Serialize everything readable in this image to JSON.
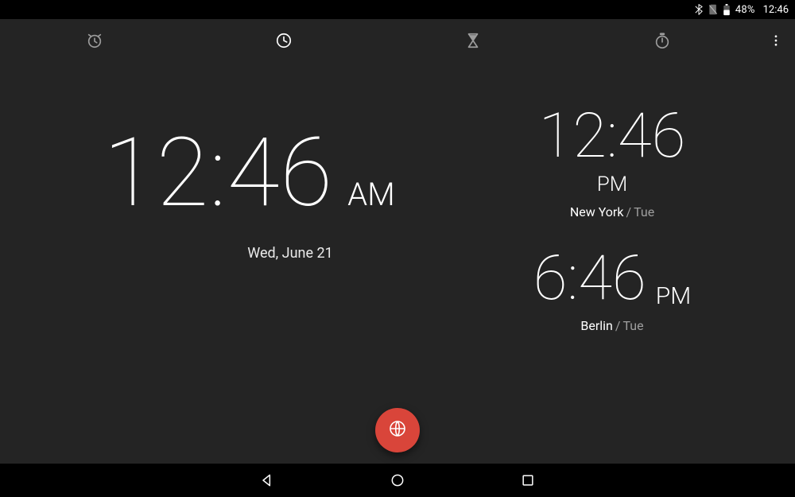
{
  "statusbar": {
    "battery_pct": "48%",
    "time": "12:46"
  },
  "tabs": {
    "alarm": {
      "label": "Alarm"
    },
    "clock": {
      "label": "Clock"
    },
    "timer": {
      "label": "Timer"
    },
    "stopwatch": {
      "label": "Stopwatch"
    }
  },
  "local": {
    "time": "12:46",
    "ampm": "AM",
    "date": "Wed, June 21"
  },
  "world_clocks": [
    {
      "time": "12:46",
      "ampm": "PM",
      "ampm_placement": "below",
      "city": "New York",
      "day": "Tue"
    },
    {
      "time": "6:46",
      "ampm": "PM",
      "ampm_placement": "inline",
      "city": "Berlin",
      "day": "Tue"
    }
  ],
  "fab": {
    "label": "Add world clock"
  },
  "colors": {
    "app_bg": "#242424",
    "accent": "#d9453a",
    "muted": "#9e9e9e"
  }
}
